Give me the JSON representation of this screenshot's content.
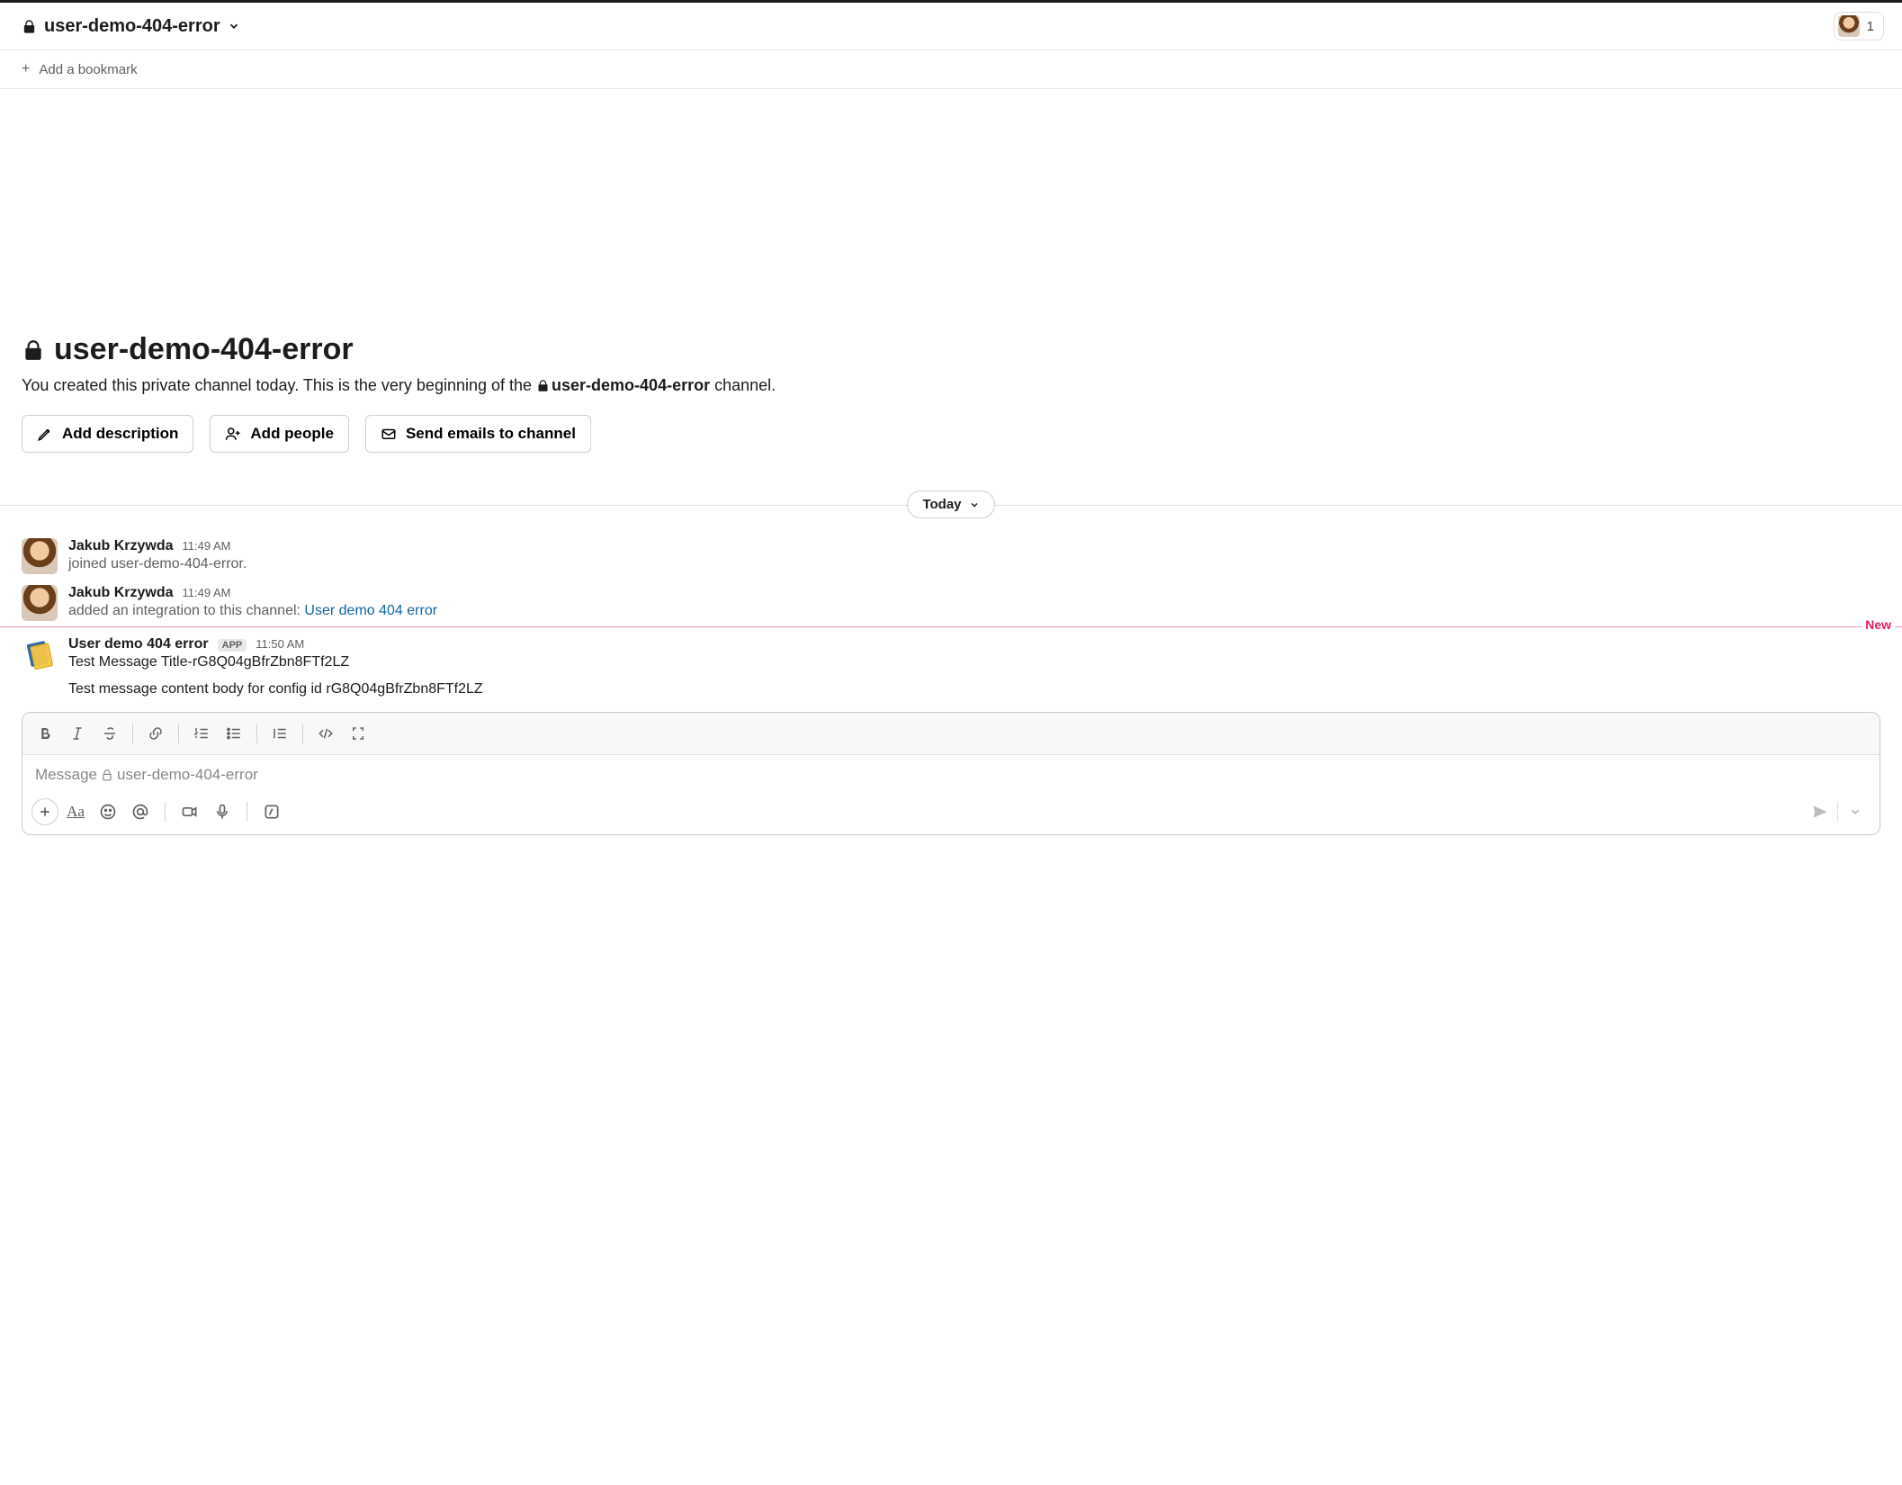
{
  "header": {
    "channel_name": "user-demo-404-error",
    "member_count": "1"
  },
  "bookmarks": {
    "add_label": "Add a bookmark"
  },
  "intro": {
    "title": "user-demo-404-error",
    "desc_prefix": "You created this private channel today. This is the very beginning of the ",
    "desc_channel": "user-demo-404-error",
    "desc_suffix": " channel.",
    "buttons": {
      "add_description": "Add description",
      "add_people": "Add people",
      "send_emails": "Send emails to channel"
    }
  },
  "divider": {
    "date_label": "Today",
    "new_label": "New"
  },
  "messages": [
    {
      "author": "Jakub Krzywda",
      "time": "11:49 AM",
      "type": "system",
      "text": "joined user-demo-404-error."
    },
    {
      "author": "Jakub Krzywda",
      "time": "11:49 AM",
      "type": "system-link",
      "text_prefix": "added an integration to this channel: ",
      "link_text": "User demo 404 error"
    },
    {
      "author": "User demo 404 error",
      "badge": "APP",
      "time": "11:50 AM",
      "type": "app",
      "line1": "Test Message Title-rG8Q04gBfrZbn8FTf2LZ",
      "line2": "Test message content body for config id rG8Q04gBfrZbn8FTf2LZ"
    }
  ],
  "composer": {
    "placeholder_prefix": "Message ",
    "placeholder_channel": "user-demo-404-error"
  }
}
